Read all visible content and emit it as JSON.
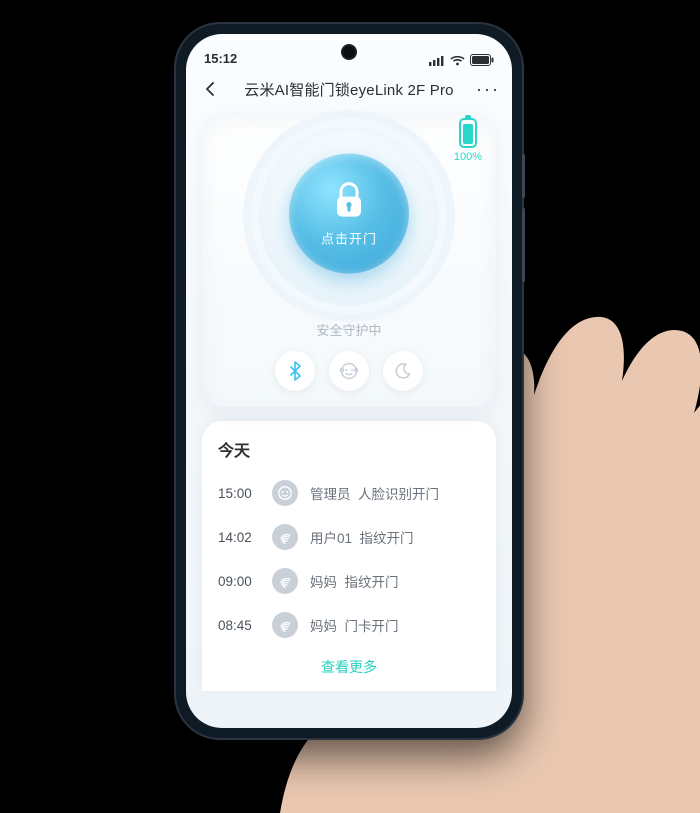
{
  "status": {
    "time": "15:12"
  },
  "header": {
    "title": "云米AI智能门锁eyeLink 2F Pro"
  },
  "battery": {
    "pct": "100%"
  },
  "lock": {
    "button_label": "点击开门",
    "status_text": "安全守护中"
  },
  "log": {
    "title": "今天",
    "items": [
      {
        "time": "15:00",
        "icon": "face",
        "user": "管理员",
        "method": "人脸识别开门"
      },
      {
        "time": "14:02",
        "icon": "fingerprint",
        "user": "用户01",
        "method": "指纹开门"
      },
      {
        "time": "09:00",
        "icon": "fingerprint",
        "user": "妈妈",
        "method": "指纹开门"
      },
      {
        "time": "08:45",
        "icon": "fingerprint",
        "user": "妈妈",
        "method": "门卡开门"
      }
    ],
    "see_more": "查看更多"
  }
}
